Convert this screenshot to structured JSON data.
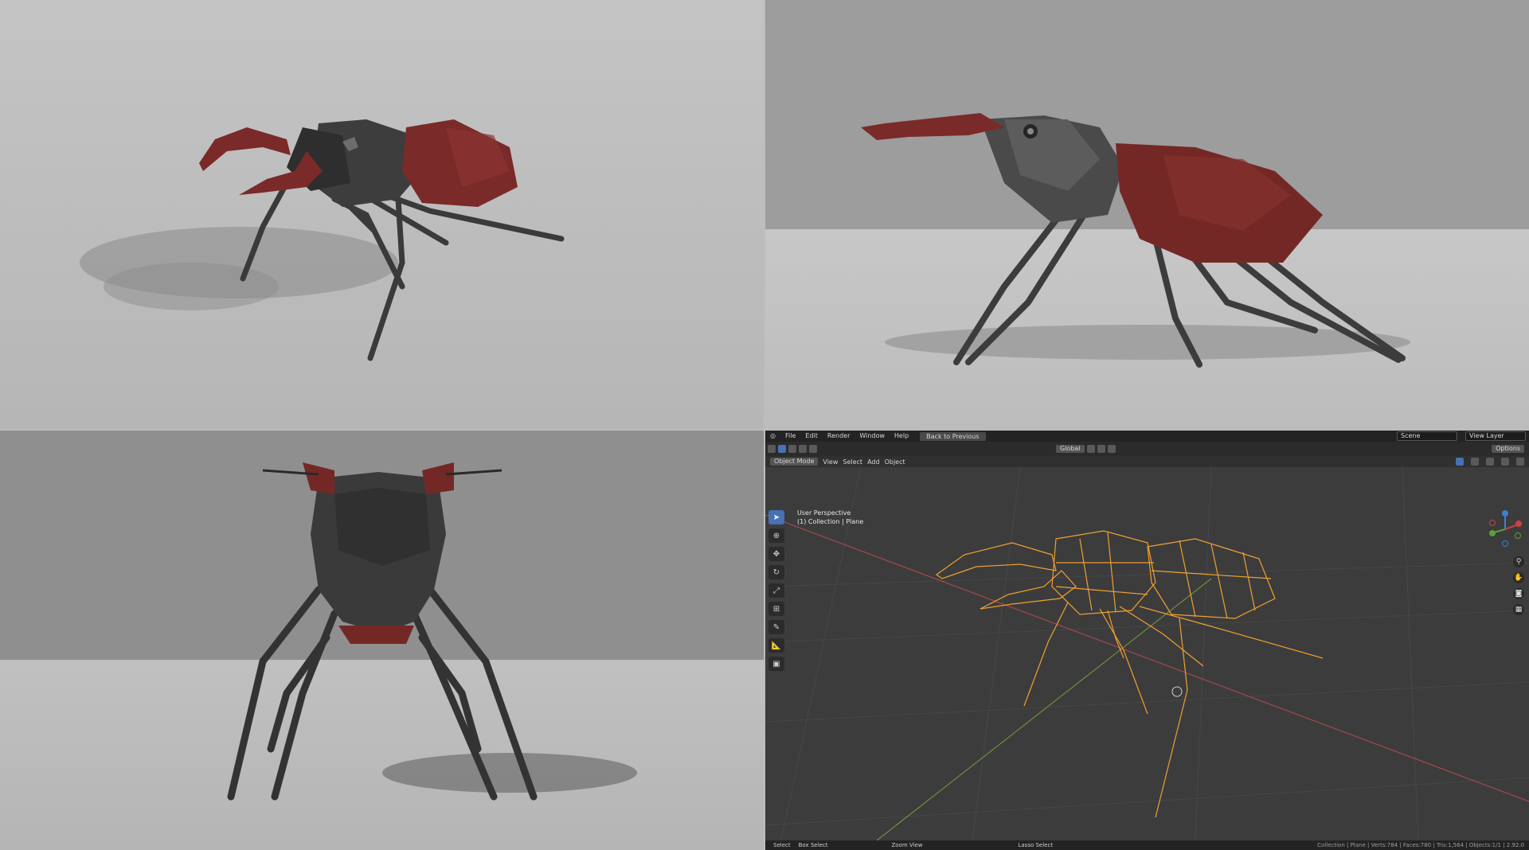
{
  "blender": {
    "menus": [
      "File",
      "Edit",
      "Render",
      "Window",
      "Help"
    ],
    "back_button": "Back to Previous",
    "scene_label": "Scene",
    "view_layer_label": "View Layer",
    "mode": "Object Mode",
    "header_menus": [
      "View",
      "Select",
      "Add",
      "Object"
    ],
    "transform_orientation": "Global",
    "options_label": "Options",
    "viewport_title": "User Perspective",
    "viewport_subtitle": "(1) Collection | Plane",
    "status_select": "Select",
    "status_box_select": "Box Select",
    "status_zoom": "Zoom View",
    "status_lasso": "Lasso Select",
    "stats": "Collection | Plane | Verts:784 | Faces:780 | Tris:1,564 | Objects:1/1 | 2.92.0"
  },
  "colors": {
    "wireframe": "#f0a030",
    "shell_red": "#7a2a28",
    "body_dark": "#3e3e3e",
    "active_tool": "#4772b3"
  }
}
